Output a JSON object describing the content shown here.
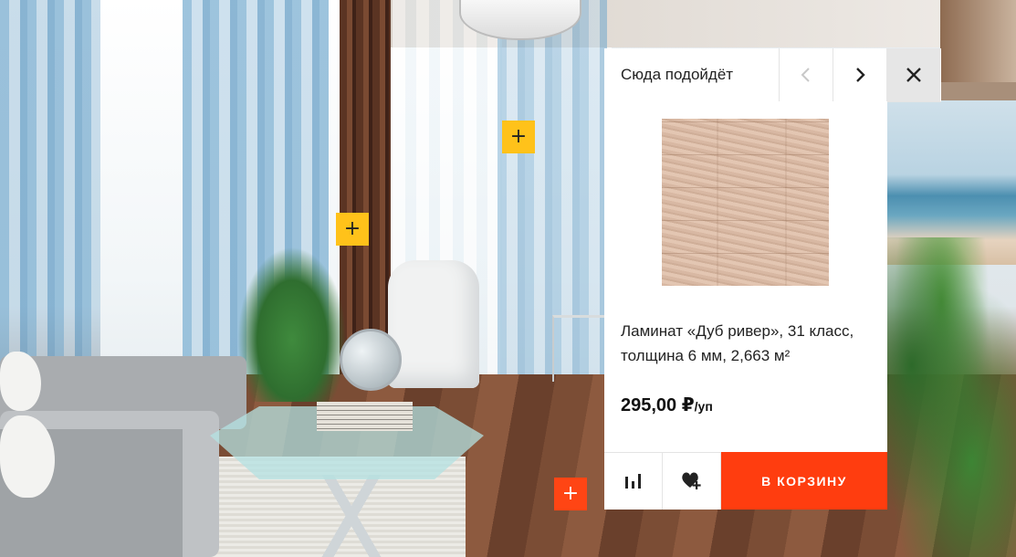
{
  "popup": {
    "title": "Сюда подойдёт",
    "product_name": "Ламинат «Дуб ривер», 31 класс, толщина 6 мм, 2,663 м²",
    "price": "295,00 ₽",
    "price_unit": "/уп",
    "cart_label": "В КОРЗИНУ",
    "icons": {
      "prev": "chevron-left-icon",
      "next": "chevron-right-icon",
      "close": "close-icon",
      "compare": "bar-chart-icon",
      "favorite": "heart-plus-icon"
    }
  },
  "hotspots": [
    {
      "label": "+",
      "color": "#ffc21a"
    },
    {
      "label": "+",
      "color": "#ffc21a"
    },
    {
      "label": "+",
      "color": "#ff4514"
    }
  ],
  "colors": {
    "accent": "#ff3d0f",
    "hotspot_yellow": "#ffc21a",
    "disabled_nav": "#c8c8c8"
  }
}
